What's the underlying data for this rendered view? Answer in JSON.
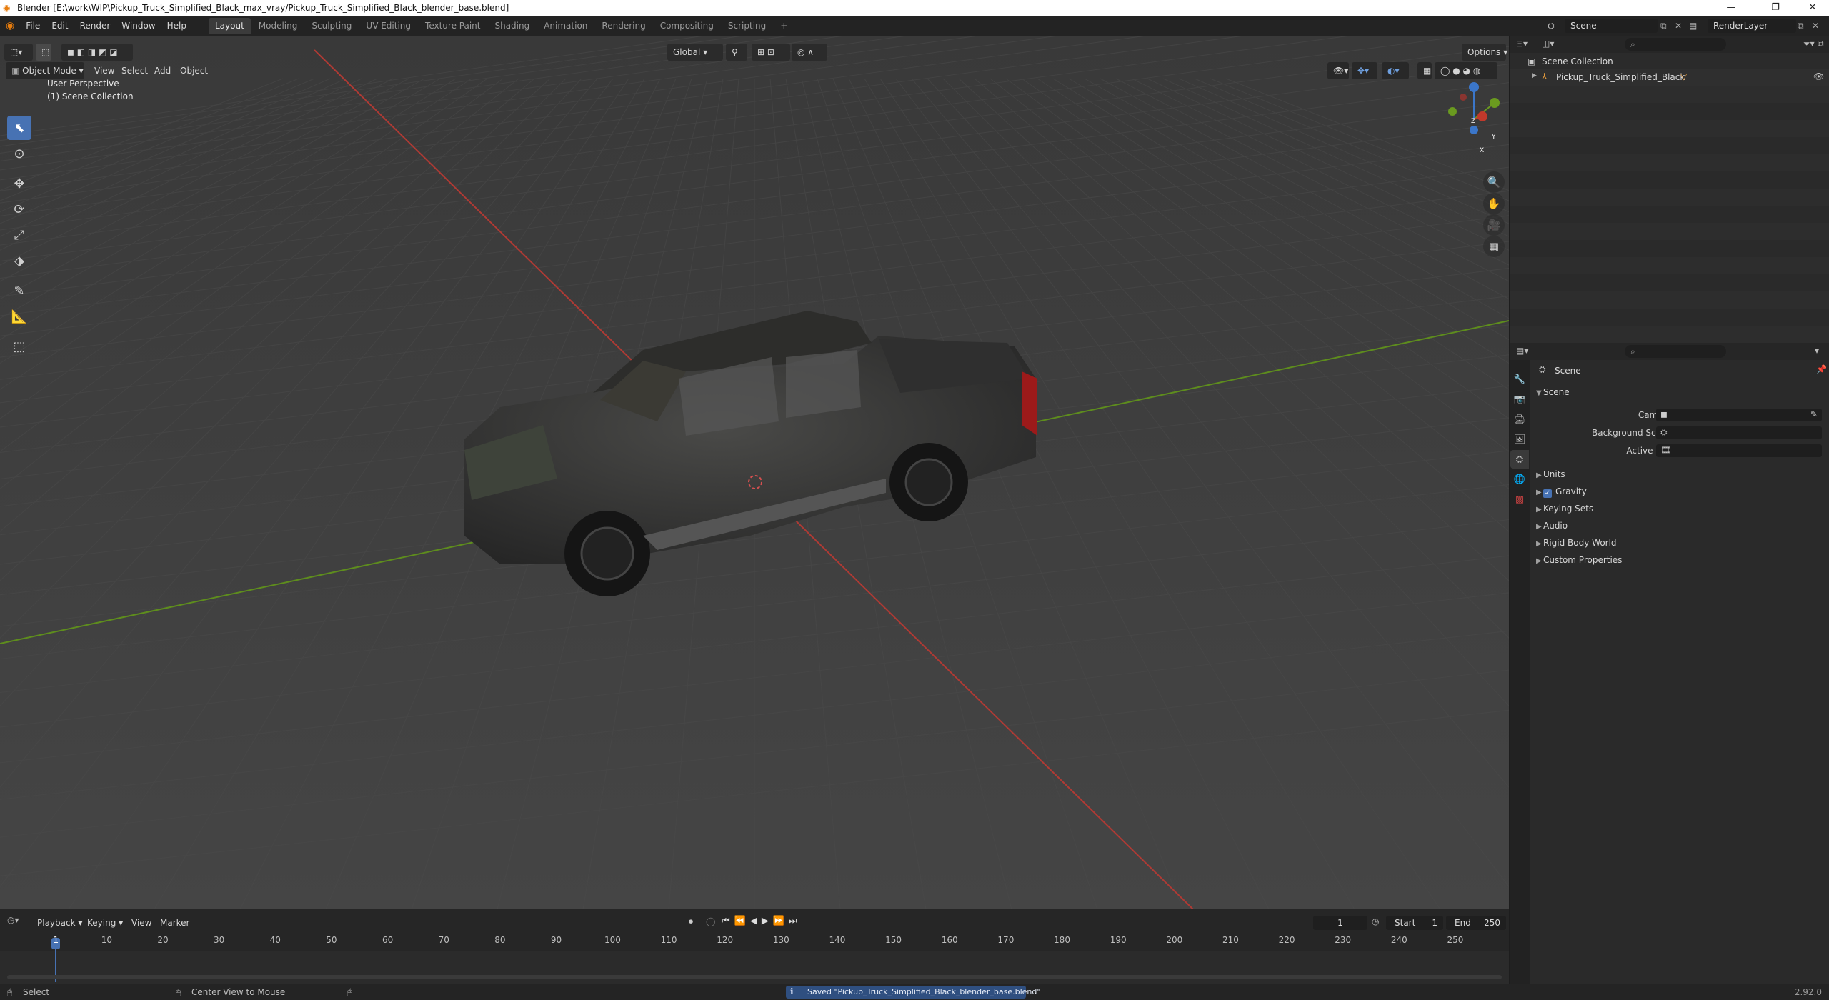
{
  "window": {
    "title": "Blender [E:\\work\\WIP\\Pickup_Truck_Simplified_Black_max_vray/Pickup_Truck_Simplified_Black_blender_base.blend]",
    "minimize_glyph": "—",
    "restore_glyph": "❐",
    "close_glyph": "✕"
  },
  "menu": {
    "items": [
      "File",
      "Edit",
      "Render",
      "Window",
      "Help"
    ]
  },
  "workspaces": {
    "tabs": [
      "Layout",
      "Modeling",
      "Sculpting",
      "UV Editing",
      "Texture Paint",
      "Shading",
      "Animation",
      "Rendering",
      "Compositing",
      "Scripting"
    ],
    "active": "Layout",
    "add_glyph": "+"
  },
  "top_right": {
    "scene_name": "Scene",
    "view_layer_name": "RenderLayer"
  },
  "viewport": {
    "mode": "Object Mode",
    "menus": [
      "View",
      "Select",
      "Add",
      "Object"
    ],
    "transform_orientation": "Global",
    "options_label": "Options",
    "perspective_label": "User Perspective",
    "collection_label": "(1) Scene Collection",
    "gizmo_axes": [
      "X",
      "Y",
      "Z"
    ]
  },
  "outliner": {
    "root": "Scene Collection",
    "items": [
      {
        "name": "Pickup_Truck_Simplified_Black"
      }
    ]
  },
  "properties": {
    "context_name": "Scene",
    "panel_title": "Scene",
    "fields": [
      {
        "label": "Camera"
      },
      {
        "label": "Background Scene"
      },
      {
        "label": "Active Clip"
      }
    ],
    "subpanels": [
      {
        "label": "Units",
        "checkbox": false
      },
      {
        "label": "Gravity",
        "checkbox": true
      },
      {
        "label": "Keying Sets",
        "checkbox": false
      },
      {
        "label": "Audio",
        "checkbox": false
      },
      {
        "label": "Rigid Body World",
        "checkbox": false
      },
      {
        "label": "Custom Properties",
        "checkbox": false
      }
    ]
  },
  "timeline": {
    "menus": [
      "Playback",
      "Keying",
      "View",
      "Marker"
    ],
    "current_frame": "1",
    "start_label": "Start",
    "start_value": "1",
    "end_label": "End",
    "end_value": "250",
    "ruler_frames": [
      "1",
      "10",
      "20",
      "30",
      "40",
      "50",
      "60",
      "70",
      "80",
      "90",
      "100",
      "110",
      "120",
      "130",
      "140",
      "150",
      "160",
      "170",
      "180",
      "190",
      "200",
      "210",
      "220",
      "230",
      "240",
      "250"
    ]
  },
  "status": {
    "left_action": "Select",
    "middle_action": "Center View to Mouse",
    "message": "Saved \"Pickup_Truck_Simplified_Black_blender_base.blend\"",
    "version": "2.92.0"
  },
  "colors": {
    "accent": "#4772b3",
    "x_axis": "#c0392b",
    "y_axis": "#6a9a1f",
    "background": "#3d3d3d"
  }
}
